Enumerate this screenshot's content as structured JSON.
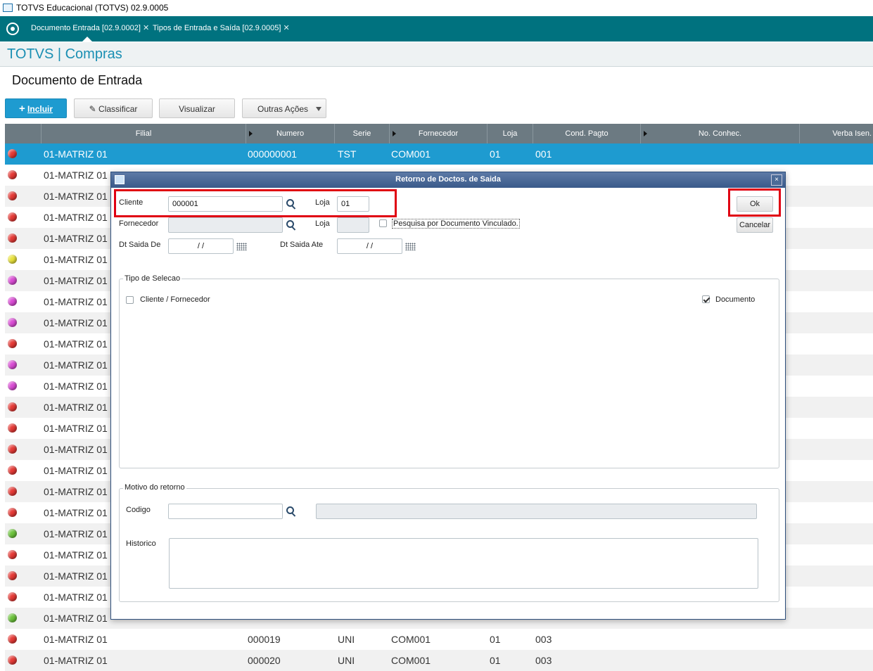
{
  "window": {
    "title": "TOTVS Educacional (TOTVS) 02.9.0005"
  },
  "tabs": [
    {
      "label": "Documento Entrada [02.9.0002]"
    },
    {
      "label": "Tipos de Entrada e Saída [02.9.0005]"
    }
  ],
  "module": {
    "title": "TOTVS | Compras"
  },
  "page": {
    "title": "Documento de Entrada"
  },
  "toolbar": {
    "incluir": "Incluir",
    "classificar": "Classificar",
    "visualizar": "Visualizar",
    "outras_acoes": "Outras Ações"
  },
  "grid": {
    "columns": [
      "Filial",
      "Numero",
      "Serie",
      "Fornecedor",
      "Loja",
      "Cond. Pagto",
      "No. Conhec.",
      "Verba Isen."
    ],
    "rows": [
      {
        "status": "#e53935",
        "filial": "01-MATRIZ 01",
        "numero": "000000001",
        "serie": "TST",
        "fornecedor": "COM001",
        "loja": "01",
        "cond": "001"
      },
      {
        "status": "#e53935",
        "filial": "01-MATRIZ 01"
      },
      {
        "status": "#e53935",
        "filial": "01-MATRIZ 01"
      },
      {
        "status": "#e53935",
        "filial": "01-MATRIZ 01"
      },
      {
        "status": "#e53935",
        "filial": "01-MATRIZ 01"
      },
      {
        "status": "#e8e13a",
        "filial": "01-MATRIZ 01"
      },
      {
        "status": "#d94bd4",
        "filial": "01-MATRIZ 01"
      },
      {
        "status": "#d94bd4",
        "filial": "01-MATRIZ 01"
      },
      {
        "status": "#d94bd4",
        "filial": "01-MATRIZ 01"
      },
      {
        "status": "#e53935",
        "filial": "01-MATRIZ 01"
      },
      {
        "status": "#d94bd4",
        "filial": "01-MATRIZ 01"
      },
      {
        "status": "#d94bd4",
        "filial": "01-MATRIZ 01"
      },
      {
        "status": "#e53935",
        "filial": "01-MATRIZ 01"
      },
      {
        "status": "#e53935",
        "filial": "01-MATRIZ 01"
      },
      {
        "status": "#e53935",
        "filial": "01-MATRIZ 01"
      },
      {
        "status": "#e53935",
        "filial": "01-MATRIZ 01"
      },
      {
        "status": "#e53935",
        "filial": "01-MATRIZ 01"
      },
      {
        "status": "#e53935",
        "filial": "01-MATRIZ 01"
      },
      {
        "status": "#6bc23a",
        "filial": "01-MATRIZ 01"
      },
      {
        "status": "#e53935",
        "filial": "01-MATRIZ 01"
      },
      {
        "status": "#e53935",
        "filial": "01-MATRIZ 01"
      },
      {
        "status": "#e53935",
        "filial": "01-MATRIZ 01"
      },
      {
        "status": "#6bc23a",
        "filial": "01-MATRIZ 01"
      },
      {
        "status": "#e53935",
        "filial": "01-MATRIZ 01",
        "numero": "000019",
        "serie": "UNI",
        "fornecedor": "COM001",
        "loja": "01",
        "cond": "003"
      },
      {
        "status": "#e53935",
        "filial": "01-MATRIZ 01",
        "numero": "000020",
        "serie": "UNI",
        "fornecedor": "COM001",
        "loja": "01",
        "cond": "003"
      }
    ]
  },
  "dialog": {
    "title": "Retorno de Doctos. de Saida",
    "close": "×",
    "cliente_label": "Cliente",
    "cliente_value": "000001",
    "loja_label": "Loja",
    "loja_value": "01",
    "fornecedor_label": "Fornecedor",
    "fornecedor_value": "",
    "loja2_label": "Loja",
    "loja2_value": "",
    "pesquisa_label": "Pesquisa por Documento Vinculado.",
    "dt_saida_de_label": "Dt Saida De",
    "dt_saida_de_value": "/ /",
    "dt_saida_ate_label": "Dt Saida Ate",
    "dt_saida_ate_value": "/ /",
    "ok_label": "Ok",
    "cancelar_label": "Cancelar",
    "tipo_selecao_title": "Tipo de Selecao",
    "cliente_fornecedor_label": "Cliente / Fornecedor",
    "cliente_fornecedor_checked": false,
    "documento_label": "Documento",
    "documento_checked": true,
    "motivo_title": "Motivo do retorno",
    "codigo_label": "Codigo",
    "codigo_value": "",
    "historico_label": "Historico",
    "historico_value": "",
    "highlight_color": "#e00012"
  }
}
